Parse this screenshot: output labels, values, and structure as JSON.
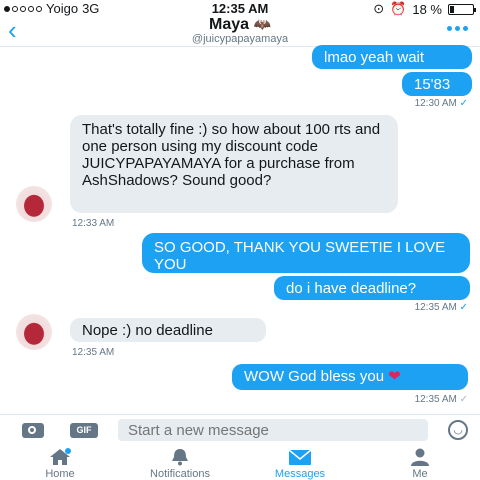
{
  "status_bar": {
    "carrier": "Yoigo",
    "network": "3G",
    "time": "12:35 AM",
    "battery": "18 %"
  },
  "header": {
    "name": "Maya",
    "name_emoji": "bat",
    "handle": "@juicypapayamaya"
  },
  "messages": [
    {
      "text": "lmao yeah wait"
    },
    {
      "text": "15'83"
    },
    {
      "timestamp": "12:30 AM"
    },
    {
      "text": "That's totally fine :) so how about 100 rts and one person using my discount code JUICYPAPAYAMAYA for a purchase from AshShadows? Sound good?"
    },
    {
      "timestamp": "12:33 AM"
    },
    {
      "text": "SO GOOD, THANK YOU SWEETIE I LOVE YOU"
    },
    {
      "text": "do i have deadline?"
    },
    {
      "timestamp": "12:35 AM"
    },
    {
      "text": "Nope :) no deadline"
    },
    {
      "timestamp": "12:35 AM"
    },
    {
      "text": "WOW God bless you",
      "emoji": "heart"
    },
    {
      "timestamp": "12:35 AM"
    }
  ],
  "compose": {
    "gif_label": "GIF",
    "placeholder": "Start a new message"
  },
  "tabs": [
    {
      "label": "Home",
      "icon": "home-icon"
    },
    {
      "label": "Notifications",
      "icon": "bell-icon"
    },
    {
      "label": "Messages",
      "icon": "envelope-icon",
      "active": true
    },
    {
      "label": "Me",
      "icon": "person-icon"
    }
  ],
  "colors": {
    "accent": "#1da1f2",
    "incoming_bubble": "#e6ecf0",
    "heart": "#e0245e"
  }
}
